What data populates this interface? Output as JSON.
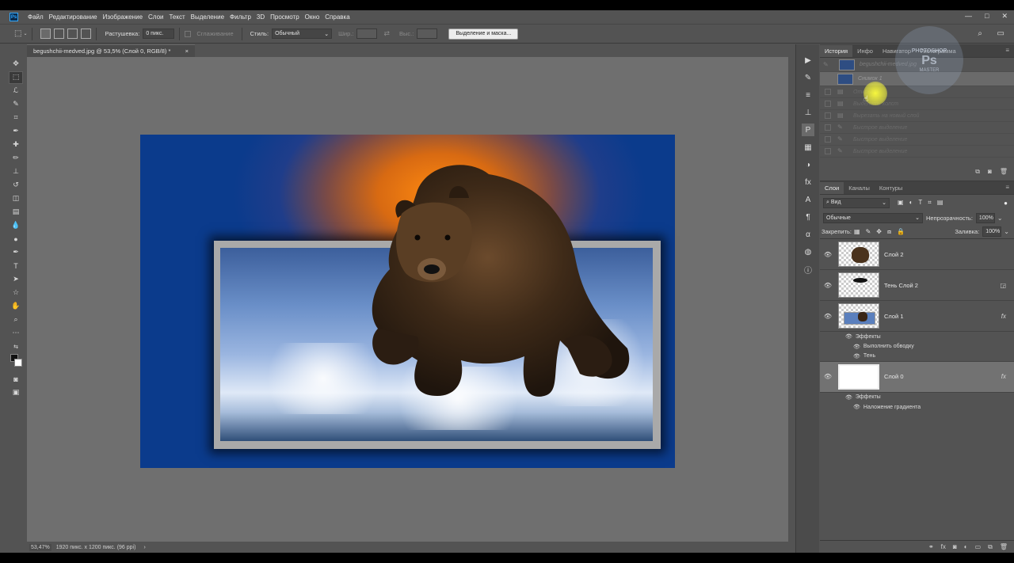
{
  "app": {
    "logo": "Ps",
    "menu": [
      "Файл",
      "Редактирование",
      "Изображение",
      "Слои",
      "Текст",
      "Выделение",
      "Фильтр",
      "3D",
      "Просмотр",
      "Окно",
      "Справка"
    ],
    "window_controls": [
      "—",
      "□",
      "✕"
    ]
  },
  "options": {
    "feather_label": "Растушевка:",
    "feather_value": "0 пикс.",
    "antialias_label": "Сглаживание",
    "style_label": "Стиль:",
    "style_value": "Обычный",
    "width_label": "Шир.:",
    "height_label": "Выс.:",
    "select_mask_label": "Выделение и маска..."
  },
  "document": {
    "tab_title": "begushchii-medved.jpg @ 53,5% (Слой 0, RGB/8) *",
    "close": "×",
    "zoom": "53,47%",
    "info": "1920 пикс. x 1200 пикс. (96 ppi)"
  },
  "history_panel": {
    "tabs": [
      "История",
      "Инфо",
      "Навигатор",
      "Гистограмма"
    ],
    "snapshot_name": "begushchii-medved.jpg",
    "items": [
      "Снимок 1",
      "Открыть",
      "Выделить холст",
      "Вырезать на новый слой",
      "Быстрое выделение",
      "Быстрое выделение",
      "Быстрое выделение"
    ]
  },
  "watermark": {
    "text_top": "PHOTOSHOP",
    "text_bottom": "MASTER"
  },
  "layers_panel": {
    "tabs": [
      "Слои",
      "Каналы",
      "Контуры"
    ],
    "filter_kind": "Вид",
    "blend_mode": "Обычные",
    "opacity_label": "Непрозрачность:",
    "opacity_value": "100%",
    "lock_label": "Закрепить:",
    "fill_label": "Заливка:",
    "fill_value": "100%",
    "layers": [
      {
        "name": "Слой 2"
      },
      {
        "name": "Тень Слой 2"
      },
      {
        "name": "Слой 1",
        "fx": "fx",
        "effects_label": "Эффекты",
        "effects": [
          "Выполнить обводку",
          "Тень"
        ]
      },
      {
        "name": "Слой 0",
        "fx": "fx",
        "effects_label": "Эффекты",
        "effects": [
          "Наложение градиента"
        ]
      }
    ]
  }
}
